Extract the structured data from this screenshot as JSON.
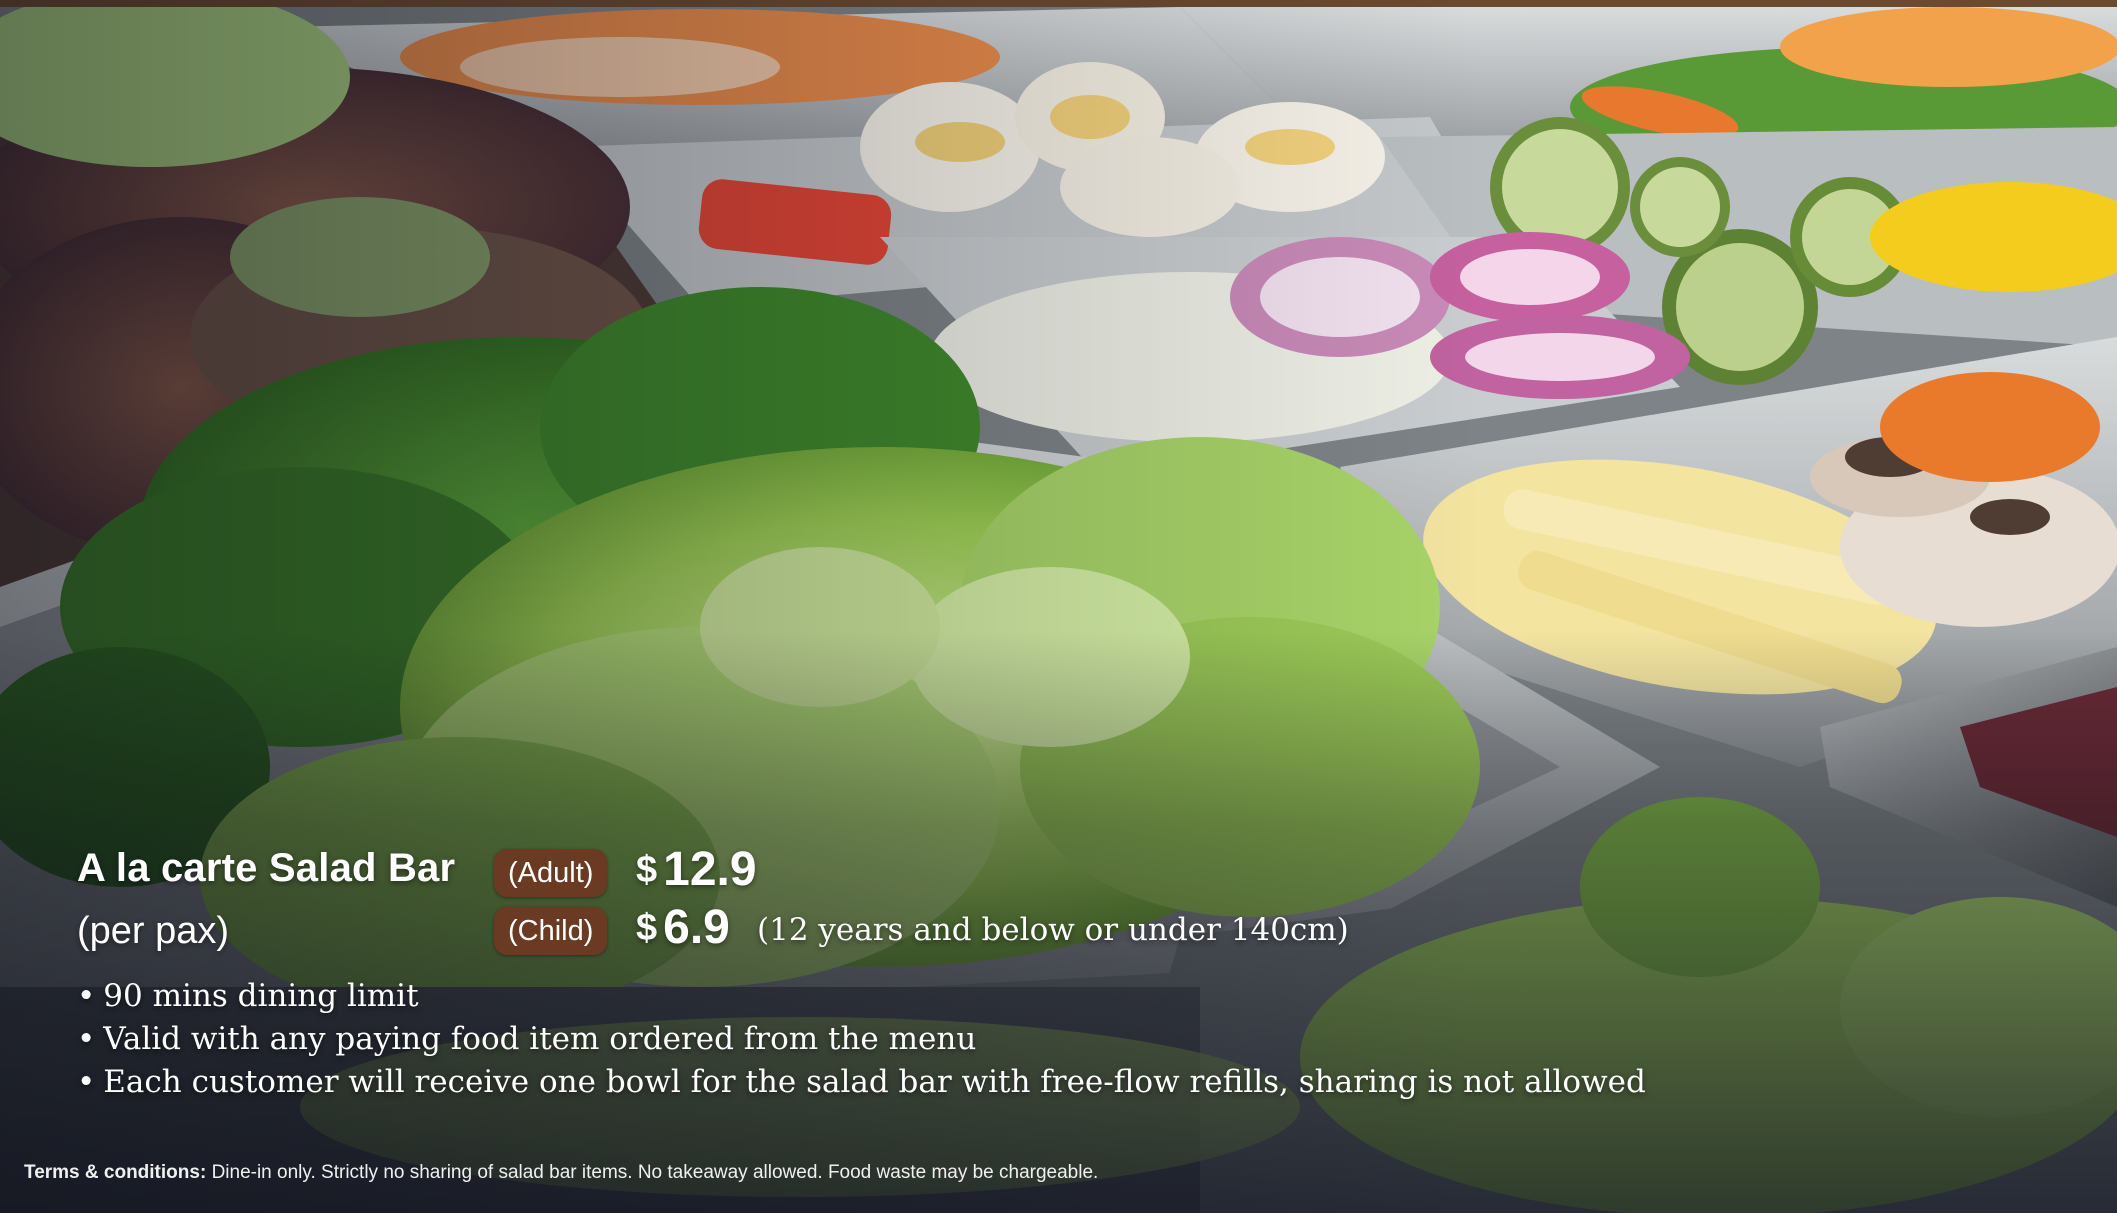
{
  "promo": {
    "title": "A la carte Salad Bar",
    "subtitle": "(per pax)",
    "adult_label": "(Adult)",
    "adult_currency": "$",
    "adult_price": "12.9",
    "child_label": "(Child)",
    "child_currency": "$",
    "child_price": "6.9",
    "child_note": "(12 years and below or under 140cm)"
  },
  "bullets": [
    "90 mins dining limit",
    "Valid with any paying food item ordered from the menu",
    "Each customer will receive one bowl for the salad bar with free-flow refills, sharing is not allowed"
  ],
  "terms": {
    "label": "Terms & conditions:",
    "text": "Dine-in only. Strictly no sharing of salad bar items. No takeaway allowed. Food waste may be chargeable."
  },
  "colors": {
    "pill_bg": "#6a3a22",
    "top_bar": "#6b4a30"
  }
}
